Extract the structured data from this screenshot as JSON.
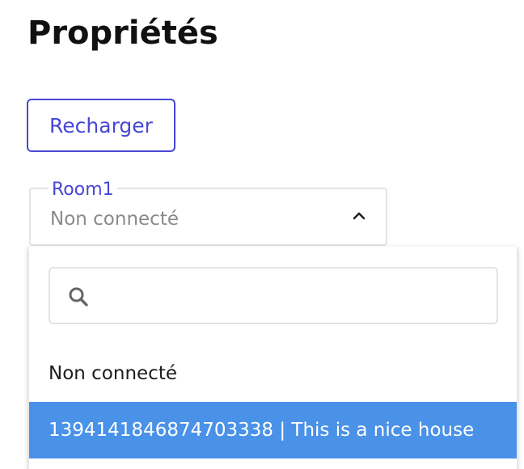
{
  "page": {
    "title": "Propriétés"
  },
  "toolbar": {
    "reload_label": "Recharger"
  },
  "select": {
    "label": "Room1",
    "value": "Non connecté",
    "expanded": true,
    "icon": "chevron-up-icon"
  },
  "dropdown": {
    "search": {
      "placeholder": "",
      "value": "",
      "icon": "search-icon"
    },
    "options": [
      {
        "label": "Non connecté",
        "highlighted": false
      },
      {
        "label": "1394141846874703338 | This is a nice house",
        "highlighted": true
      }
    ]
  },
  "colors": {
    "accent": "#4747d6",
    "highlight": "#4a92e8",
    "border": "#e4e4e4",
    "muted_text": "#8a8a8a"
  }
}
